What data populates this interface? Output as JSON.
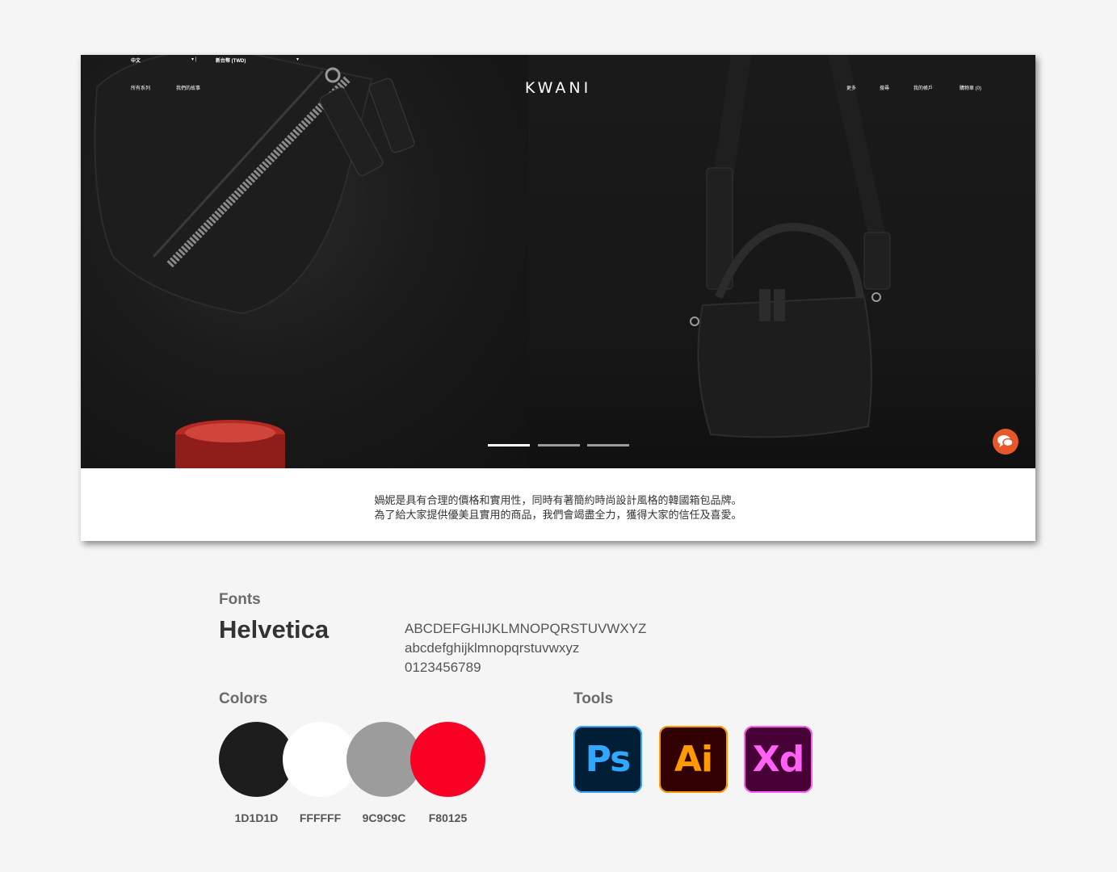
{
  "site": {
    "language_select": "中文",
    "currency_select": "新台幣 (TWD)",
    "nav_left": [
      "所有系列",
      "我們的故事"
    ],
    "logo": "KWANI",
    "nav_right": [
      "更多",
      "搜尋",
      "我的帳戶",
      "購物車 (0)"
    ],
    "slides_total": 3,
    "slide_active": 1,
    "intro_line1": "媧妮是具有合理的價格和實用性，同時有著簡約時尚設計風格的韓國箱包品牌。",
    "intro_line2": "為了給大家提供優美且實用的商品，我們會竭盡全力，獲得大家的信任及喜愛。"
  },
  "guide": {
    "fonts_title": "Fonts",
    "font_name": "Helvetica",
    "uppercase": "ABCDEFGHIJKLMNOPQRSTUVWXYZ",
    "lowercase": "abcdefghijklmnopqrstuvwxyz",
    "digits": "0123456789",
    "colors_title": "Colors",
    "colors": [
      {
        "label": "1D1D1D",
        "hex": "#1D1D1D"
      },
      {
        "label": "FFFFFF",
        "hex": "#FFFFFF"
      },
      {
        "label": "9C9C9C",
        "hex": "#9C9C9C"
      },
      {
        "label": "F80125",
        "hex": "#F80125"
      }
    ],
    "tools_title": "Tools",
    "tools": [
      {
        "label": "Ps",
        "bg": "#001E36",
        "fg": "#31A8FF"
      },
      {
        "label": "Ai",
        "bg": "#330000",
        "fg": "#FF9A00"
      },
      {
        "label": "Xd",
        "bg": "#470137",
        "fg": "#FF61F6"
      }
    ]
  }
}
